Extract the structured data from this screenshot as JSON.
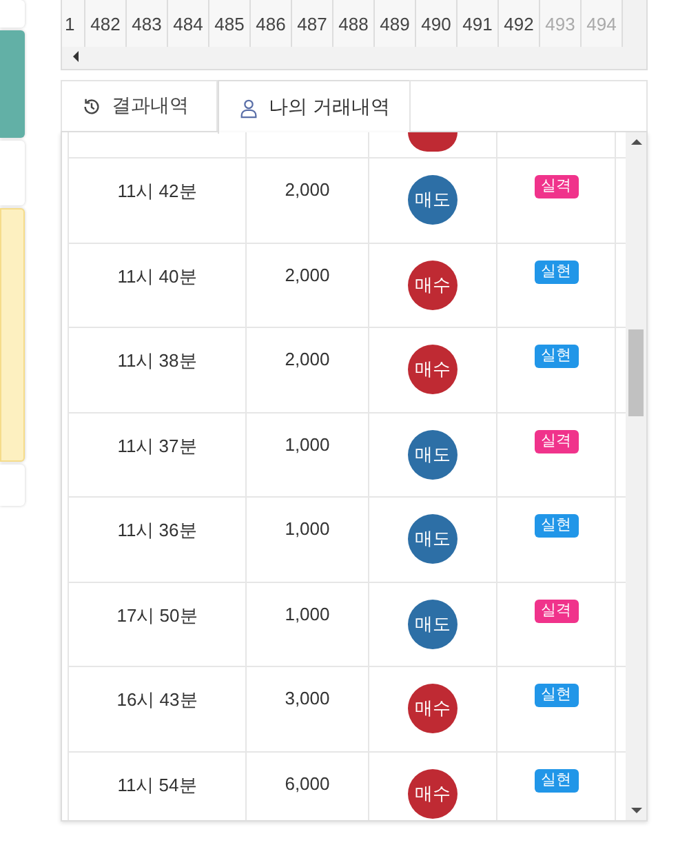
{
  "number_strip": {
    "cells": [
      "1",
      "482",
      "483",
      "484",
      "485",
      "486",
      "487",
      "488",
      "489",
      "490",
      "491",
      "492",
      "493",
      "494"
    ]
  },
  "tabs": [
    {
      "label": "결과내역",
      "selected": false
    },
    {
      "label": "나의 거래내역",
      "selected": true
    }
  ],
  "trades": {
    "partial_top_row": {
      "kind": "buy"
    },
    "rows": [
      {
        "time": "11시 42분",
        "amount": "2,000",
        "type": {
          "kind": "sell",
          "label": "매도"
        },
        "result": {
          "kind": "fail",
          "label": "실격"
        }
      },
      {
        "time": "11시 40분",
        "amount": "2,000",
        "type": {
          "kind": "buy",
          "label": "매수"
        },
        "result": {
          "kind": "success",
          "label": "실현"
        }
      },
      {
        "time": "11시 38분",
        "amount": "2,000",
        "type": {
          "kind": "buy",
          "label": "매수"
        },
        "result": {
          "kind": "success",
          "label": "실현"
        }
      },
      {
        "time": "11시 37분",
        "amount": "1,000",
        "type": {
          "kind": "sell",
          "label": "매도"
        },
        "result": {
          "kind": "fail",
          "label": "실격"
        }
      },
      {
        "time": "11시 36분",
        "amount": "1,000",
        "type": {
          "kind": "sell",
          "label": "매도"
        },
        "result": {
          "kind": "success",
          "label": "실현"
        }
      },
      {
        "time": "17시 50분",
        "amount": "1,000",
        "type": {
          "kind": "sell",
          "label": "매도"
        },
        "result": {
          "kind": "fail",
          "label": "실격"
        }
      },
      {
        "time": "16시 43분",
        "amount": "3,000",
        "type": {
          "kind": "buy",
          "label": "매수"
        },
        "result": {
          "kind": "success",
          "label": "실현"
        }
      },
      {
        "time": "11시 54분",
        "amount": "6,000",
        "type": {
          "kind": "buy",
          "label": "매수"
        },
        "result": {
          "kind": "success",
          "label": "실현"
        }
      }
    ]
  }
}
